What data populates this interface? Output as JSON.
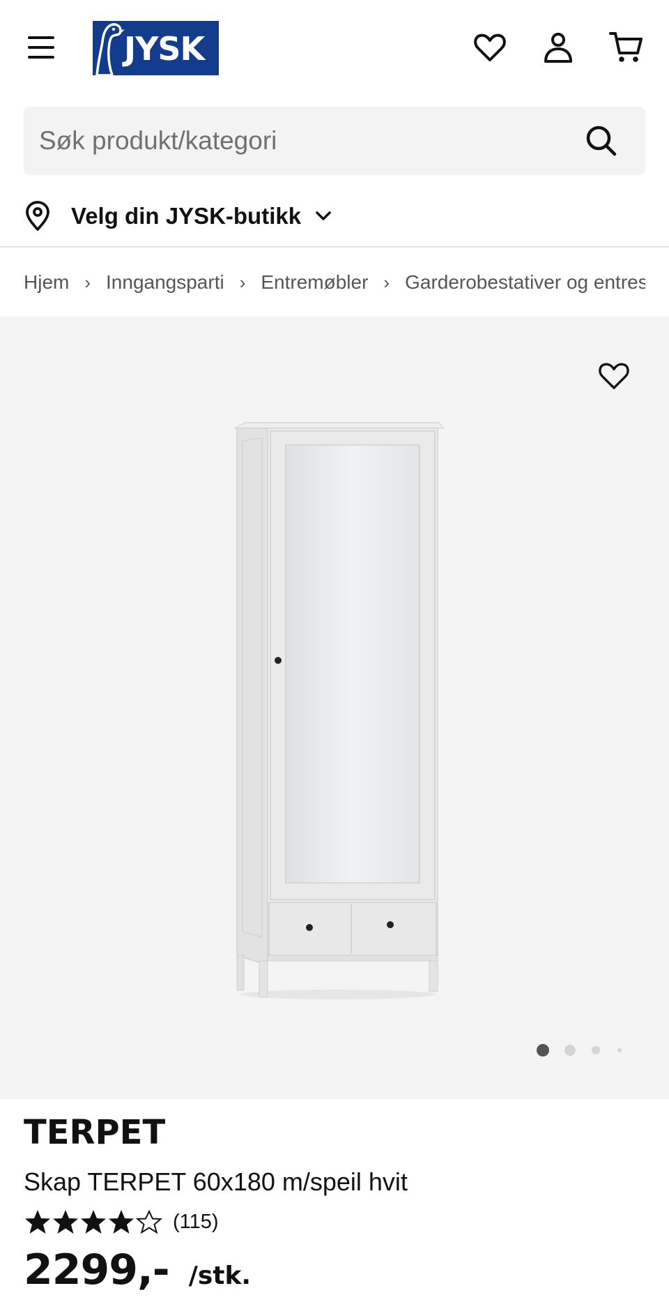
{
  "header": {
    "logo_text": "JYSK",
    "brand_color": "#143c8c",
    "icons": [
      "menu-icon",
      "heart-icon",
      "user-icon",
      "cart-icon"
    ]
  },
  "search": {
    "placeholder": "Søk produkt/kategori"
  },
  "store": {
    "label": "Velg din JYSK-butikk"
  },
  "breadcrumb": [
    "Hjem",
    "Inngangsparti",
    "Entremøbler",
    "Garderobestativer og entreskap"
  ],
  "gallery": {
    "slide_count": 4,
    "active_slide": 1
  },
  "product": {
    "brand": "TERPET",
    "name": "Skap TERPET 60x180 m/speil hvit",
    "rating": 4,
    "rating_max": 5,
    "review_count": "(115)",
    "price": "2299,-",
    "unit": "/stk."
  }
}
